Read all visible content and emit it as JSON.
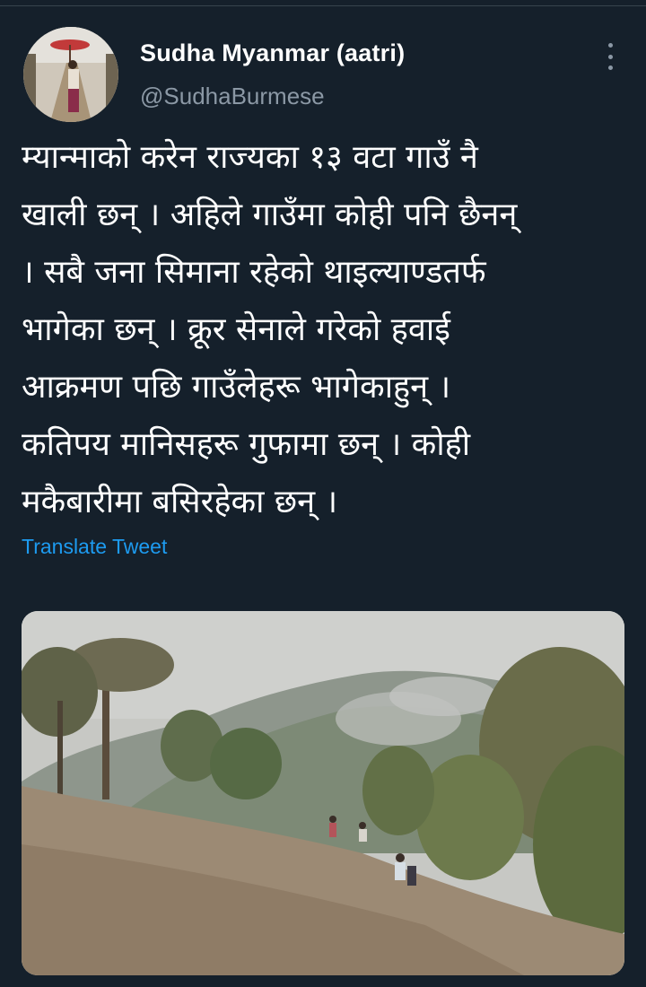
{
  "tweet": {
    "author_name": "Sudha Myanmar (aatri)",
    "handle": "@SudhaBurmese",
    "text": "म्यान्माको करेन राज्यका १३ वटा गाउँ नै\nखाली छन् । अहिले गाउँमा कोही पनि छैनन्\n। सबै जना सिमाना रहेको थाइल्याण्डतर्फ\nभागेका छन् । क्रूर सेनाले गरेको हवाई\nआक्रमण पछि गाउँलेहरू भागेकाहुन् ।\nकतिपय मानिसहरू गुफामा छन् । कोही\nमकैबारीमा बसिरहेका छन् ।",
    "translate_label": "Translate Tweet"
  },
  "icons": {
    "more": "more-vertical-icon"
  },
  "colors": {
    "background": "#15202b",
    "primary_text": "#ffffff",
    "secondary_text": "#8b98a5",
    "link": "#1d9bf0"
  }
}
